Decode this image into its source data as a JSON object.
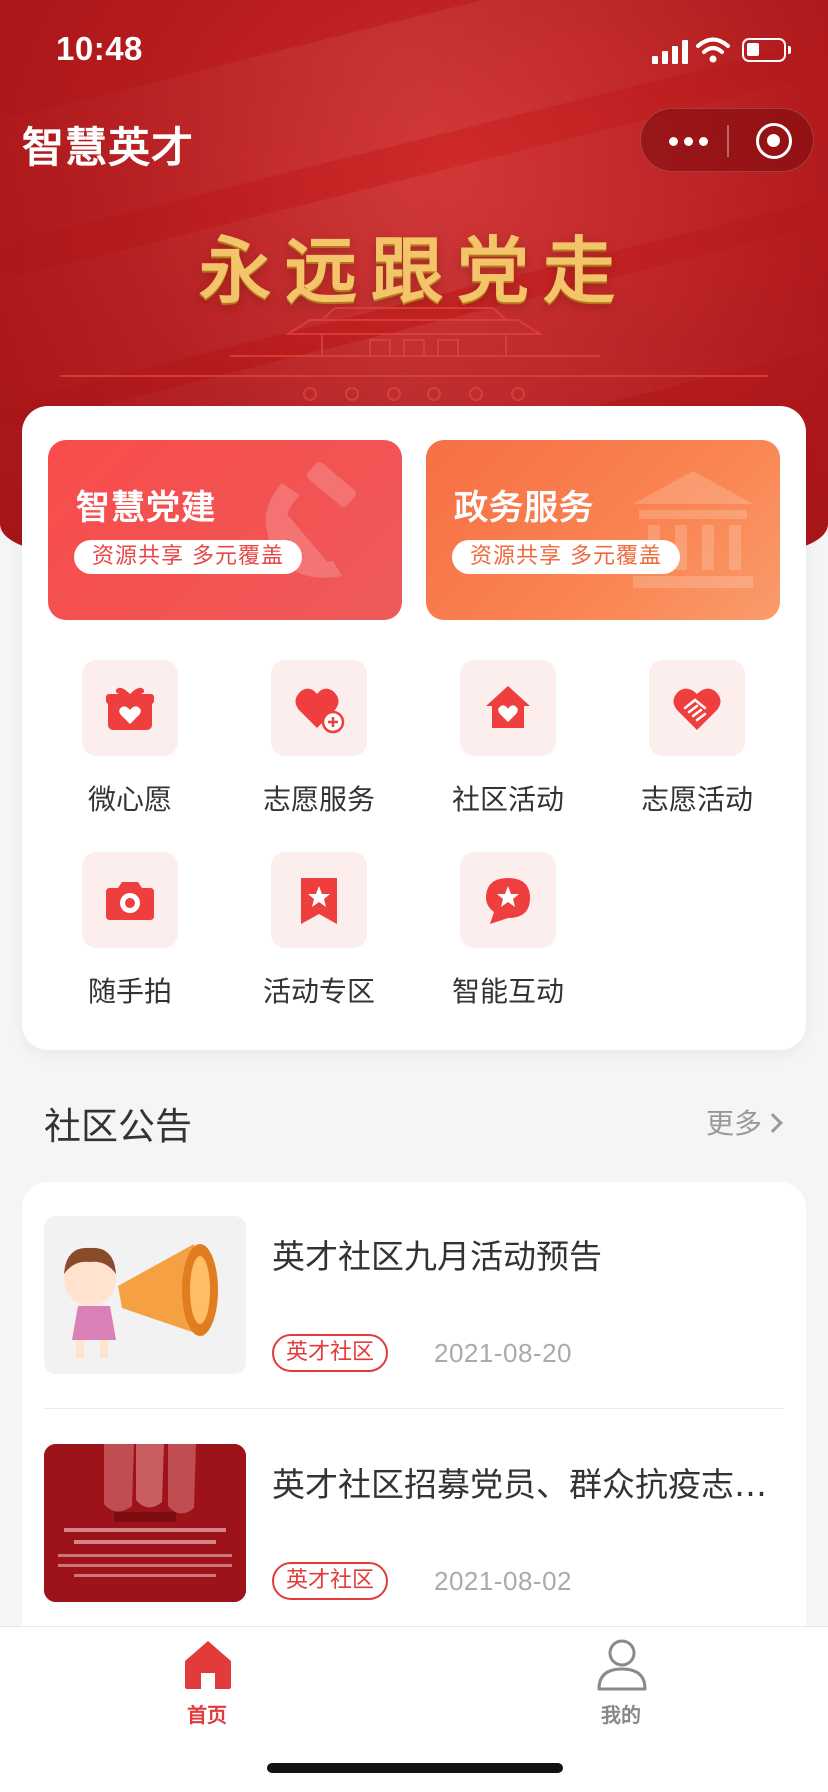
{
  "status_bar": {
    "time": "10:48"
  },
  "header": {
    "app_title": "智慧英才",
    "banner_slogan": "永远跟党走"
  },
  "promos": [
    {
      "title": "智慧党建",
      "subtitle": "资源共享 多元覆盖",
      "icon": "hammer-sickle-icon",
      "color": "#f35252"
    },
    {
      "title": "政务服务",
      "subtitle": "资源共享 多元覆盖",
      "icon": "government-building-icon",
      "color": "#f98552"
    }
  ],
  "grid": [
    {
      "label": "微心愿",
      "icon": "gift-heart-icon"
    },
    {
      "label": "志愿服务",
      "icon": "heart-plus-icon"
    },
    {
      "label": "社区活动",
      "icon": "house-heart-icon"
    },
    {
      "label": "志愿活动",
      "icon": "handshake-heart-icon"
    },
    {
      "label": "随手拍",
      "icon": "camera-icon"
    },
    {
      "label": "活动专区",
      "icon": "bookmark-star-icon"
    },
    {
      "label": "智能互动",
      "icon": "chat-star-icon"
    }
  ],
  "notices": {
    "title": "社区公告",
    "more": "更多",
    "items": [
      {
        "title": "英才社区九月活动预告",
        "tag": "英才社区",
        "date": "2021-08-20"
      },
      {
        "title": "英才社区招募党员、群众抗疫志愿者",
        "tag": "英才社区",
        "date": "2021-08-02"
      }
    ]
  },
  "tabbar": {
    "tabs": [
      {
        "label": "首页",
        "icon": "home-icon",
        "active": true
      },
      {
        "label": "我的",
        "icon": "user-icon",
        "active": false
      }
    ]
  },
  "colors": {
    "primary_red": "#e23b3b",
    "banner_red": "#b31a1c",
    "gold": "#f4c46a",
    "icon_bg": "#fdeeee"
  }
}
